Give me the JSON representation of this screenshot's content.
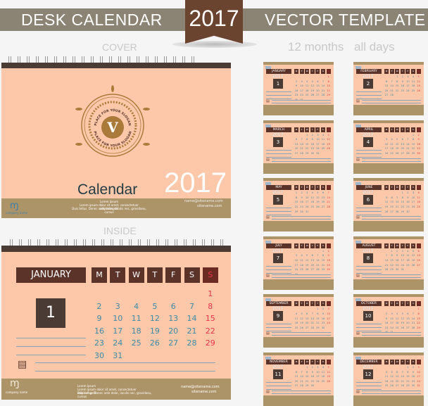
{
  "header": {
    "left": "DESK CALENDAR",
    "year": "2017",
    "right": "VECTOR TEMPLATE"
  },
  "labels": {
    "cover": "COVER",
    "inside": "INSIDE",
    "months": "12 months",
    "days": "all days"
  },
  "cover": {
    "title": "Calendar",
    "year": "2017",
    "emblem_letter": "V",
    "slogan": "PLACE FOR YOUR SLOGAN",
    "company": "company name",
    "lorem_title": "Lorem Ipsum",
    "lorem1": "Lorem ipsum dolor sit amet, consectetuer adipiscingelit",
    "lorem2": "Duis tellus. Donec ante dolor, iaculis nec, gravidaeu, cursus",
    "email": "name@sitename.com",
    "site": "sitename.com"
  },
  "inside": {
    "month": "JANUARY",
    "day_box": "1",
    "weekdays": [
      "M",
      "T",
      "W",
      "T",
      "F",
      "S",
      "S"
    ],
    "start": 6,
    "days": 31,
    "company": "company name",
    "lorem_title": "Lorem Ipsum",
    "lorem1": "Lorem ipsum dolor sit amet, consectetuer adipiscingelit",
    "lorem2": "Duis tellus. Donec ante dolor, iaculis nec, gravidaeu, cursus",
    "email": "name@sitename.com",
    "site": "sitename.com"
  },
  "months": [
    {
      "name": "JANUARY",
      "days": 31,
      "start": 6
    },
    {
      "name": "FEBRUARY",
      "days": 28,
      "start": 2
    },
    {
      "name": "MARCH",
      "days": 31,
      "start": 2
    },
    {
      "name": "APRIL",
      "days": 30,
      "start": 5
    },
    {
      "name": "MAY",
      "days": 31,
      "start": 0
    },
    {
      "name": "JUNE",
      "days": 30,
      "start": 3
    },
    {
      "name": "JULY",
      "days": 31,
      "start": 5
    },
    {
      "name": "AUGUST",
      "days": 31,
      "start": 1
    },
    {
      "name": "SEPTEMBER",
      "days": 30,
      "start": 4
    },
    {
      "name": "OCTOBER",
      "days": 31,
      "start": 6
    },
    {
      "name": "NOVEMBER",
      "days": 30,
      "start": 2
    },
    {
      "name": "DECEMBER",
      "days": 31,
      "start": 4
    }
  ],
  "colors": {
    "peach": "#fdc8aa",
    "tan": "#ad9468",
    "brown": "#5b3328",
    "day_blue": "#3f8aa6",
    "sunday_red": "#e8334a"
  }
}
